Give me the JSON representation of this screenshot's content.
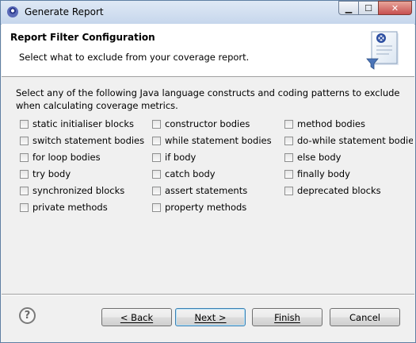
{
  "window": {
    "title": "Generate Report"
  },
  "header": {
    "title": "Report Filter Configuration",
    "subtitle": "Select what to exclude from your coverage report."
  },
  "intro": "Select any of the following Java language constructs and coding patterns to exclude when calculating coverage metrics.",
  "options": [
    {
      "label": "static initialiser blocks",
      "checked": false
    },
    {
      "label": "constructor bodies",
      "checked": false
    },
    {
      "label": "method bodies",
      "checked": false
    },
    {
      "label": "switch statement bodies",
      "checked": false
    },
    {
      "label": "while statement bodies",
      "checked": false
    },
    {
      "label": "do-while statement bodies",
      "checked": false
    },
    {
      "label": "for loop bodies",
      "checked": false
    },
    {
      "label": "if body",
      "checked": false
    },
    {
      "label": "else body",
      "checked": false
    },
    {
      "label": "try body",
      "checked": false
    },
    {
      "label": "catch body",
      "checked": false
    },
    {
      "label": "finally body",
      "checked": false
    },
    {
      "label": "synchronized blocks",
      "checked": false
    },
    {
      "label": "assert statements",
      "checked": false
    },
    {
      "label": "deprecated blocks",
      "checked": false
    },
    {
      "label": "private methods",
      "checked": false
    },
    {
      "label": "property methods",
      "checked": false
    }
  ],
  "buttons": {
    "help": "?",
    "back": "< Back",
    "next": "Next >",
    "finish": "Finish",
    "cancel": "Cancel"
  }
}
